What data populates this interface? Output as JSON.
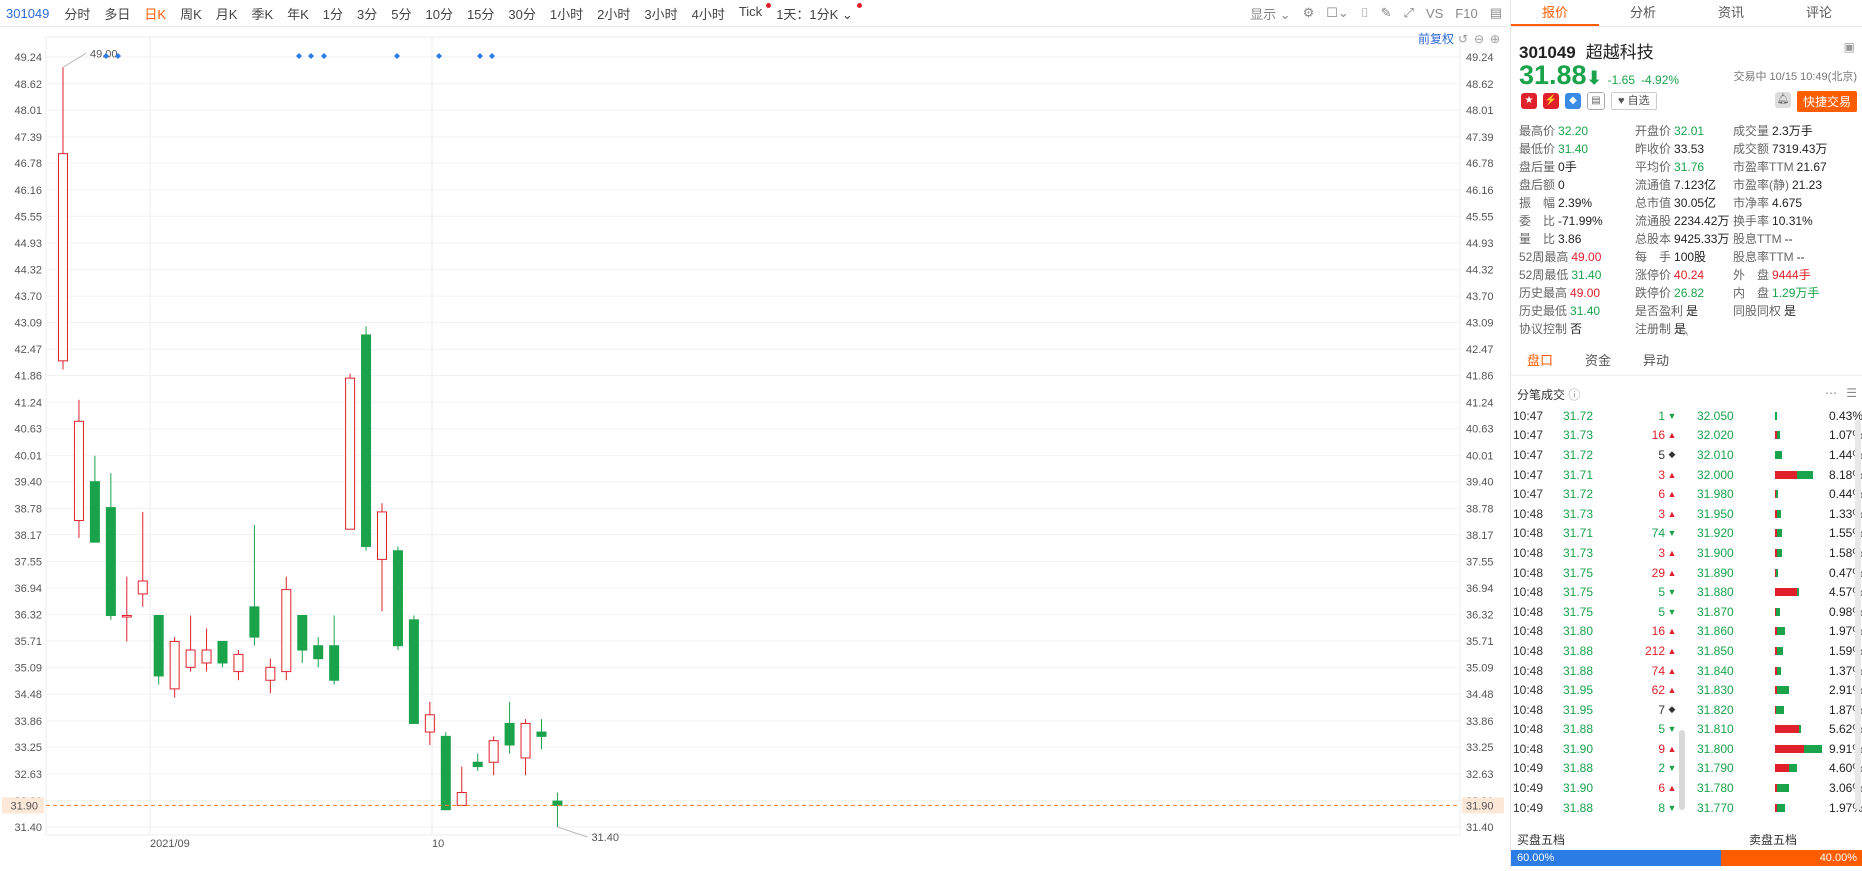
{
  "toolbar": {
    "code": "301049",
    "periods": [
      "分时",
      "多日",
      "日K",
      "周K",
      "月K",
      "季K",
      "年K",
      "1分",
      "3分",
      "5分",
      "10分",
      "15分",
      "30分",
      "1小时",
      "2小时",
      "3小时",
      "4小时",
      "Tick",
      "1天：1分K"
    ],
    "active_period": "日K",
    "display_label": "显示",
    "vs_label": "VS",
    "f10_label": "F10",
    "fuquan_label": "前复权"
  },
  "chart_data": {
    "type": "candlestick",
    "y_ticks": [
      "49.24",
      "48.62",
      "48.01",
      "47.39",
      "46.78",
      "46.16",
      "45.55",
      "44.93",
      "44.32",
      "43.70",
      "43.09",
      "42.47",
      "41.86",
      "41.24",
      "40.63",
      "40.01",
      "39.40",
      "38.78",
      "38.17",
      "37.55",
      "36.94",
      "36.32",
      "35.71",
      "35.09",
      "34.48",
      "33.86",
      "33.25",
      "32.63",
      "32.01",
      "31.40"
    ],
    "ylim": [
      31.4,
      49.24
    ],
    "current_price_label": "31.90",
    "x_labels": [
      "2021/09",
      "10"
    ],
    "max_label": "49.00",
    "min_label": "31.40",
    "candles": [
      {
        "o": 42.2,
        "h": 49.0,
        "l": 42.0,
        "c": 47.0
      },
      {
        "o": 38.5,
        "h": 41.3,
        "l": 38.1,
        "c": 40.8
      },
      {
        "o": 39.4,
        "h": 40.0,
        "l": 38.0,
        "c": 38.0
      },
      {
        "o": 38.8,
        "h": 39.6,
        "l": 36.2,
        "c": 36.3
      },
      {
        "o": 36.3,
        "h": 37.2,
        "l": 35.7,
        "c": 36.3
      },
      {
        "o": 36.8,
        "h": 38.7,
        "l": 36.5,
        "c": 37.1
      },
      {
        "o": 36.3,
        "h": 36.3,
        "l": 34.7,
        "c": 34.9
      },
      {
        "o": 34.6,
        "h": 35.8,
        "l": 34.4,
        "c": 35.7
      },
      {
        "o": 35.1,
        "h": 36.3,
        "l": 35.0,
        "c": 35.5
      },
      {
        "o": 35.2,
        "h": 36.0,
        "l": 35.0,
        "c": 35.5
      },
      {
        "o": 35.7,
        "h": 35.7,
        "l": 35.1,
        "c": 35.2
      },
      {
        "o": 35.0,
        "h": 35.5,
        "l": 34.8,
        "c": 35.4
      },
      {
        "o": 36.5,
        "h": 38.4,
        "l": 35.6,
        "c": 35.8
      },
      {
        "o": 34.8,
        "h": 35.3,
        "l": 34.5,
        "c": 35.1
      },
      {
        "o": 35.0,
        "h": 37.2,
        "l": 34.8,
        "c": 36.9
      },
      {
        "o": 36.3,
        "h": 36.3,
        "l": 35.2,
        "c": 35.5
      },
      {
        "o": 35.6,
        "h": 35.8,
        "l": 35.1,
        "c": 35.3
      },
      {
        "o": 35.6,
        "h": 36.3,
        "l": 34.7,
        "c": 34.8
      },
      {
        "o": 38.3,
        "h": 41.9,
        "l": 38.3,
        "c": 41.8
      },
      {
        "o": 42.8,
        "h": 43.0,
        "l": 37.8,
        "c": 37.9
      },
      {
        "o": 37.6,
        "h": 38.9,
        "l": 36.4,
        "c": 38.7
      },
      {
        "o": 37.8,
        "h": 37.9,
        "l": 35.5,
        "c": 35.6
      },
      {
        "o": 36.2,
        "h": 36.3,
        "l": 33.8,
        "c": 33.8
      },
      {
        "o": 33.6,
        "h": 34.3,
        "l": 33.3,
        "c": 34.0
      },
      {
        "o": 33.5,
        "h": 33.6,
        "l": 31.8,
        "c": 31.8
      },
      {
        "o": 31.9,
        "h": 32.8,
        "l": 31.9,
        "c": 32.2
      },
      {
        "o": 32.9,
        "h": 33.1,
        "l": 32.7,
        "c": 32.8
      },
      {
        "o": 32.9,
        "h": 33.5,
        "l": 32.6,
        "c": 33.4
      },
      {
        "o": 33.8,
        "h": 34.3,
        "l": 33.1,
        "c": 33.3
      },
      {
        "o": 33.0,
        "h": 33.9,
        "l": 32.6,
        "c": 33.8
      },
      {
        "o": 33.6,
        "h": 33.9,
        "l": 33.2,
        "c": 33.5
      },
      {
        "o": 32.0,
        "h": 32.2,
        "l": 31.4,
        "c": 31.9
      }
    ]
  },
  "right_panel": {
    "tabs": [
      "报价",
      "分析",
      "资讯",
      "评论"
    ],
    "code": "301049",
    "name": "超越科技",
    "price": "31.88",
    "arrow": "⬇",
    "change": "-1.65",
    "change_pct": "-4.92%",
    "status": "交易中 10/15 10:49(北京)",
    "watch_label": "自选",
    "quick_trade": "快捷交易",
    "stats": [
      [
        [
          "最高价",
          "32.20",
          "g"
        ],
        [
          "开盘价",
          "32.01",
          "g"
        ],
        [
          "成交量",
          "2.3万手",
          ""
        ]
      ],
      [
        [
          "最低价",
          "31.40",
          "g"
        ],
        [
          "昨收价",
          "33.53",
          ""
        ],
        [
          "成交额",
          "7319.43万",
          ""
        ]
      ],
      [
        [
          "盘后量",
          "0手",
          ""
        ],
        [
          "平均价",
          "31.76",
          "g"
        ],
        [
          "市盈率TTM",
          "21.67",
          ""
        ]
      ],
      [
        [
          "盘后额",
          "0",
          ""
        ],
        [
          "流通值",
          "7.123亿",
          ""
        ],
        [
          "市盈率(静)",
          "21.23",
          ""
        ]
      ],
      [
        [
          "振　幅",
          "2.39%",
          ""
        ],
        [
          "总市值",
          "30.05亿",
          ""
        ],
        [
          "市净率",
          "4.675",
          ""
        ]
      ],
      [
        [
          "委　比",
          "-71.99%",
          ""
        ],
        [
          "流通股",
          "2234.42万",
          ""
        ],
        [
          "换手率",
          "10.31%",
          ""
        ]
      ],
      [
        [
          "量　比",
          "3.86",
          ""
        ],
        [
          "总股本",
          "9425.33万",
          ""
        ],
        [
          "股息TTM",
          "--",
          ""
        ]
      ],
      [
        [
          "52周最高",
          "49.00",
          "r"
        ],
        [
          "每　手",
          "100股",
          ""
        ],
        [
          "股息率TTM",
          "--",
          ""
        ]
      ],
      [
        [
          "52周最低",
          "31.40",
          "g"
        ],
        [
          "涨停价",
          "40.24",
          "r"
        ],
        [
          "外　盘",
          "9444手",
          "r"
        ]
      ],
      [
        [
          "历史最高",
          "49.00",
          "r"
        ],
        [
          "跌停价",
          "26.82",
          "g"
        ],
        [
          "内　盘",
          "1.29万手",
          "g"
        ]
      ],
      [
        [
          "历史最低",
          "31.40",
          "g"
        ],
        [
          "是否盈利",
          "是",
          ""
        ],
        [
          "同股同权",
          "是",
          ""
        ]
      ],
      [
        [
          "协议控制",
          "否",
          ""
        ],
        [
          "注册制",
          "是",
          ""
        ],
        [
          "",
          "",
          ""
        ]
      ]
    ],
    "subtabs": [
      "盘口",
      "资金",
      "异动"
    ],
    "ticks_title": "分笔成交",
    "ticks": [
      [
        "10:47",
        "31.72",
        "1",
        "d"
      ],
      [
        "10:47",
        "31.73",
        "16",
        "u"
      ],
      [
        "10:47",
        "31.72",
        "5",
        "n"
      ],
      [
        "10:47",
        "31.71",
        "3",
        "u"
      ],
      [
        "10:47",
        "31.72",
        "6",
        "u"
      ],
      [
        "10:48",
        "31.73",
        "3",
        "u"
      ],
      [
        "10:48",
        "31.71",
        "74",
        "d"
      ],
      [
        "10:48",
        "31.73",
        "3",
        "u"
      ],
      [
        "10:48",
        "31.75",
        "29",
        "u"
      ],
      [
        "10:48",
        "31.75",
        "5",
        "d"
      ],
      [
        "10:48",
        "31.75",
        "5",
        "d"
      ],
      [
        "10:48",
        "31.80",
        "16",
        "u"
      ],
      [
        "10:48",
        "31.88",
        "212",
        "u"
      ],
      [
        "10:48",
        "31.88",
        "74",
        "u"
      ],
      [
        "10:48",
        "31.95",
        "62",
        "u"
      ],
      [
        "10:48",
        "31.95",
        "7",
        "n"
      ],
      [
        "10:48",
        "31.88",
        "5",
        "d"
      ],
      [
        "10:48",
        "31.90",
        "9",
        "u"
      ],
      [
        "10:49",
        "31.88",
        "2",
        "d"
      ],
      [
        "10:49",
        "31.90",
        "6",
        "u"
      ],
      [
        "10:49",
        "31.88",
        "8",
        "d"
      ]
    ],
    "book": [
      [
        "32.050",
        "0.43%",
        0.0,
        0.04
      ],
      [
        "32.020",
        "1.07%",
        0.05,
        0.1
      ],
      [
        "32.010",
        "1.44%",
        0.0,
        0.14
      ],
      [
        "32.000",
        "8.18%",
        0.45,
        0.8
      ],
      [
        "31.980",
        "0.44%",
        0.03,
        0.04
      ],
      [
        "31.950",
        "1.33%",
        0.05,
        0.13
      ],
      [
        "31.920",
        "1.55%",
        0.04,
        0.15
      ],
      [
        "31.900",
        "1.58%",
        0.05,
        0.15
      ],
      [
        "31.890",
        "0.47%",
        0.03,
        0.05
      ],
      [
        "31.880",
        "4.57%",
        0.45,
        0.45
      ],
      [
        "31.870",
        "0.98%",
        0.02,
        0.1
      ],
      [
        "31.860",
        "1.97%",
        0.05,
        0.2
      ],
      [
        "31.850",
        "1.59%",
        0.05,
        0.16
      ],
      [
        "31.840",
        "1.37%",
        0.05,
        0.13
      ],
      [
        "31.830",
        "2.91%",
        0.05,
        0.3
      ],
      [
        "31.820",
        "1.87%",
        0.03,
        0.19
      ],
      [
        "31.810",
        "5.62%",
        0.5,
        0.55
      ],
      [
        "31.800",
        "9.91%",
        0.6,
        0.98
      ],
      [
        "31.790",
        "4.60%",
        0.3,
        0.46
      ],
      [
        "31.780",
        "3.06%",
        0.05,
        0.3
      ],
      [
        "31.770",
        "1.97%",
        0.05,
        0.2
      ]
    ],
    "buy5": "买盘五档",
    "sell5": "卖盘五档",
    "buy_pct": "60.00%",
    "sell_pct": "40.00%"
  },
  "colors": {
    "up": "#e0202b",
    "down": "#1aa34a",
    "accent": "#ff5d00"
  }
}
